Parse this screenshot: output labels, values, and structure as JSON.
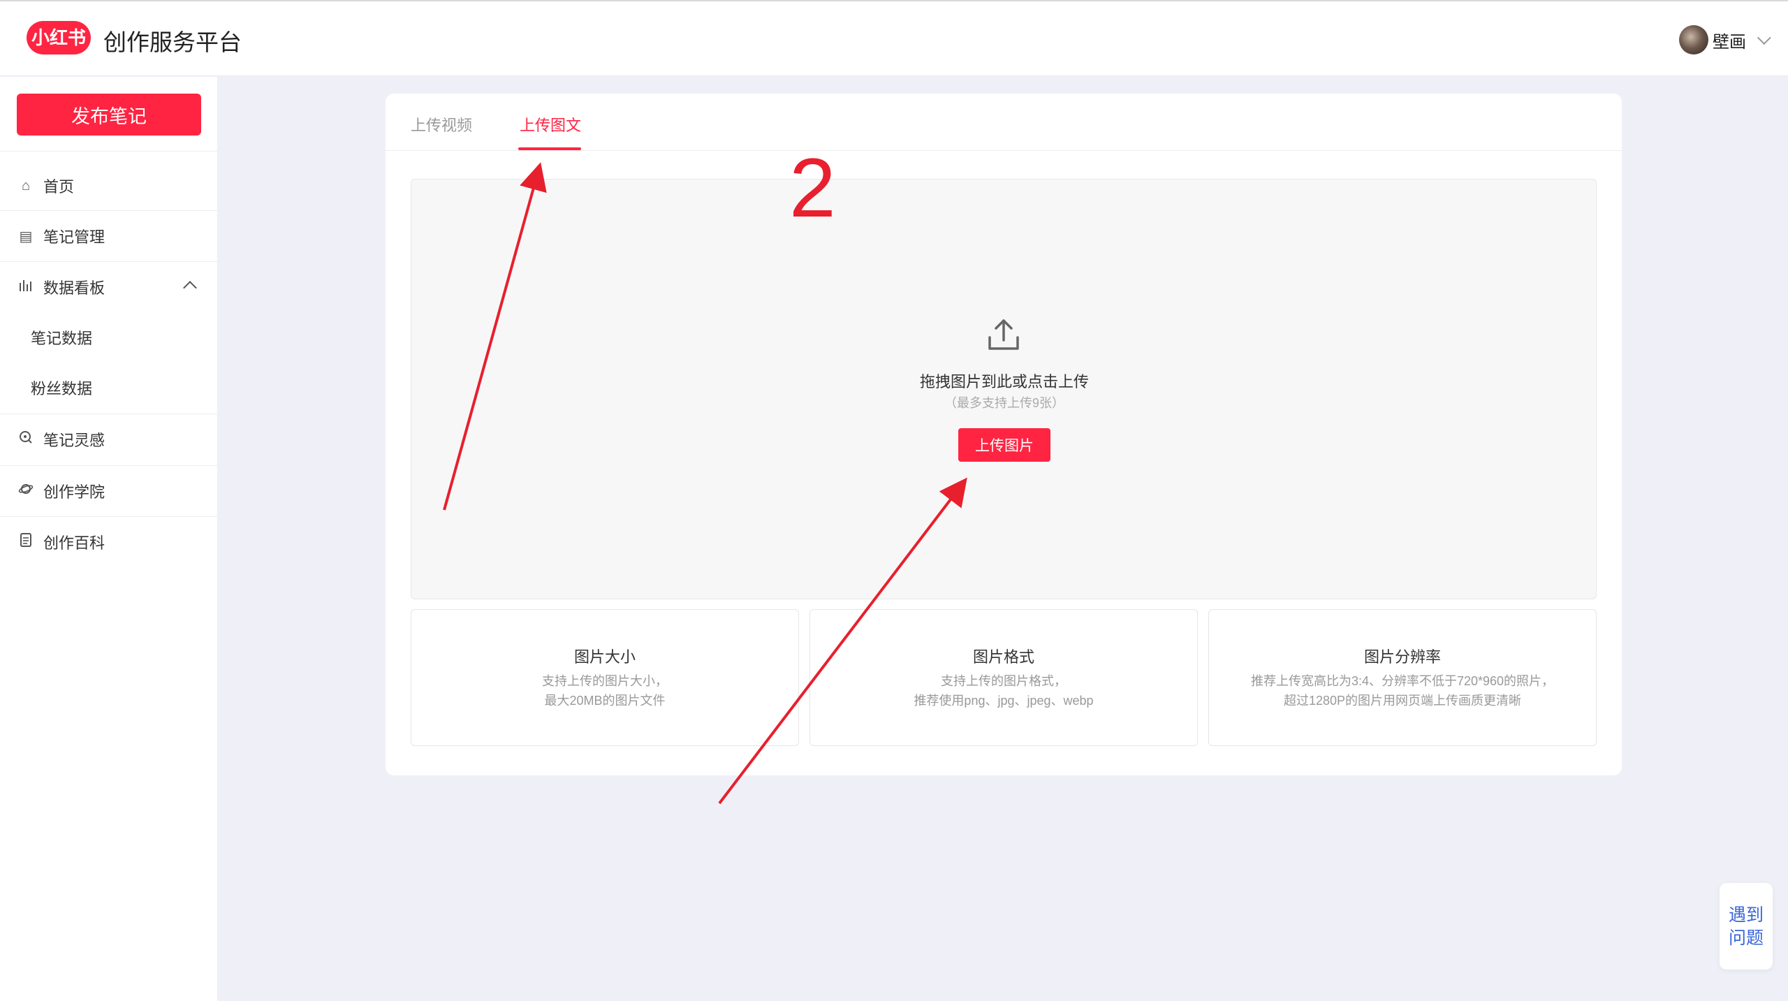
{
  "header": {
    "logo_text": "小红书",
    "app_title": "创作服务平台",
    "user_name": "壁画"
  },
  "sidebar": {
    "publish_label": "发布笔记",
    "items": [
      {
        "label": "首页",
        "icon": "home-icon"
      },
      {
        "label": "笔记管理",
        "icon": "note-icon"
      },
      {
        "label": "数据看板",
        "icon": "chart-icon",
        "expanded": true
      },
      {
        "label": "笔记数据",
        "icon": ""
      },
      {
        "label": "粉丝数据",
        "icon": ""
      },
      {
        "label": "笔记灵感",
        "icon": "inspiration-icon"
      },
      {
        "label": "创作学院",
        "icon": "planet-icon"
      },
      {
        "label": "创作百科",
        "icon": "book-icon"
      }
    ]
  },
  "tabs": {
    "video": "上传视频",
    "image": "上传图文",
    "active": "上传图文"
  },
  "dropzone": {
    "title": "拖拽图片到此或点击上传",
    "hint": "（最多支持上传9张）",
    "button": "上传图片"
  },
  "info_boxes": [
    {
      "title": "图片大小",
      "line1": "支持上传的图片大小，",
      "line2": "最大20MB的图片文件"
    },
    {
      "title": "图片格式",
      "line1": "支持上传的图片格式，",
      "line2": "推荐使用png、jpg、jpeg、webp"
    },
    {
      "title": "图片分辨率",
      "line1": "推荐上传宽高比为3:4、分辨率不低于720*960的照片，",
      "line2": "超过1280P的图片用网页端上传画质更清晰"
    }
  ],
  "help": {
    "line1": "遇到",
    "line2": "问题"
  },
  "annotation": {
    "step_number": "2",
    "color": "#e8202d"
  },
  "colors": {
    "brand": "#ff2442",
    "help_link": "#3a66d8",
    "background": "#eff0f7"
  }
}
